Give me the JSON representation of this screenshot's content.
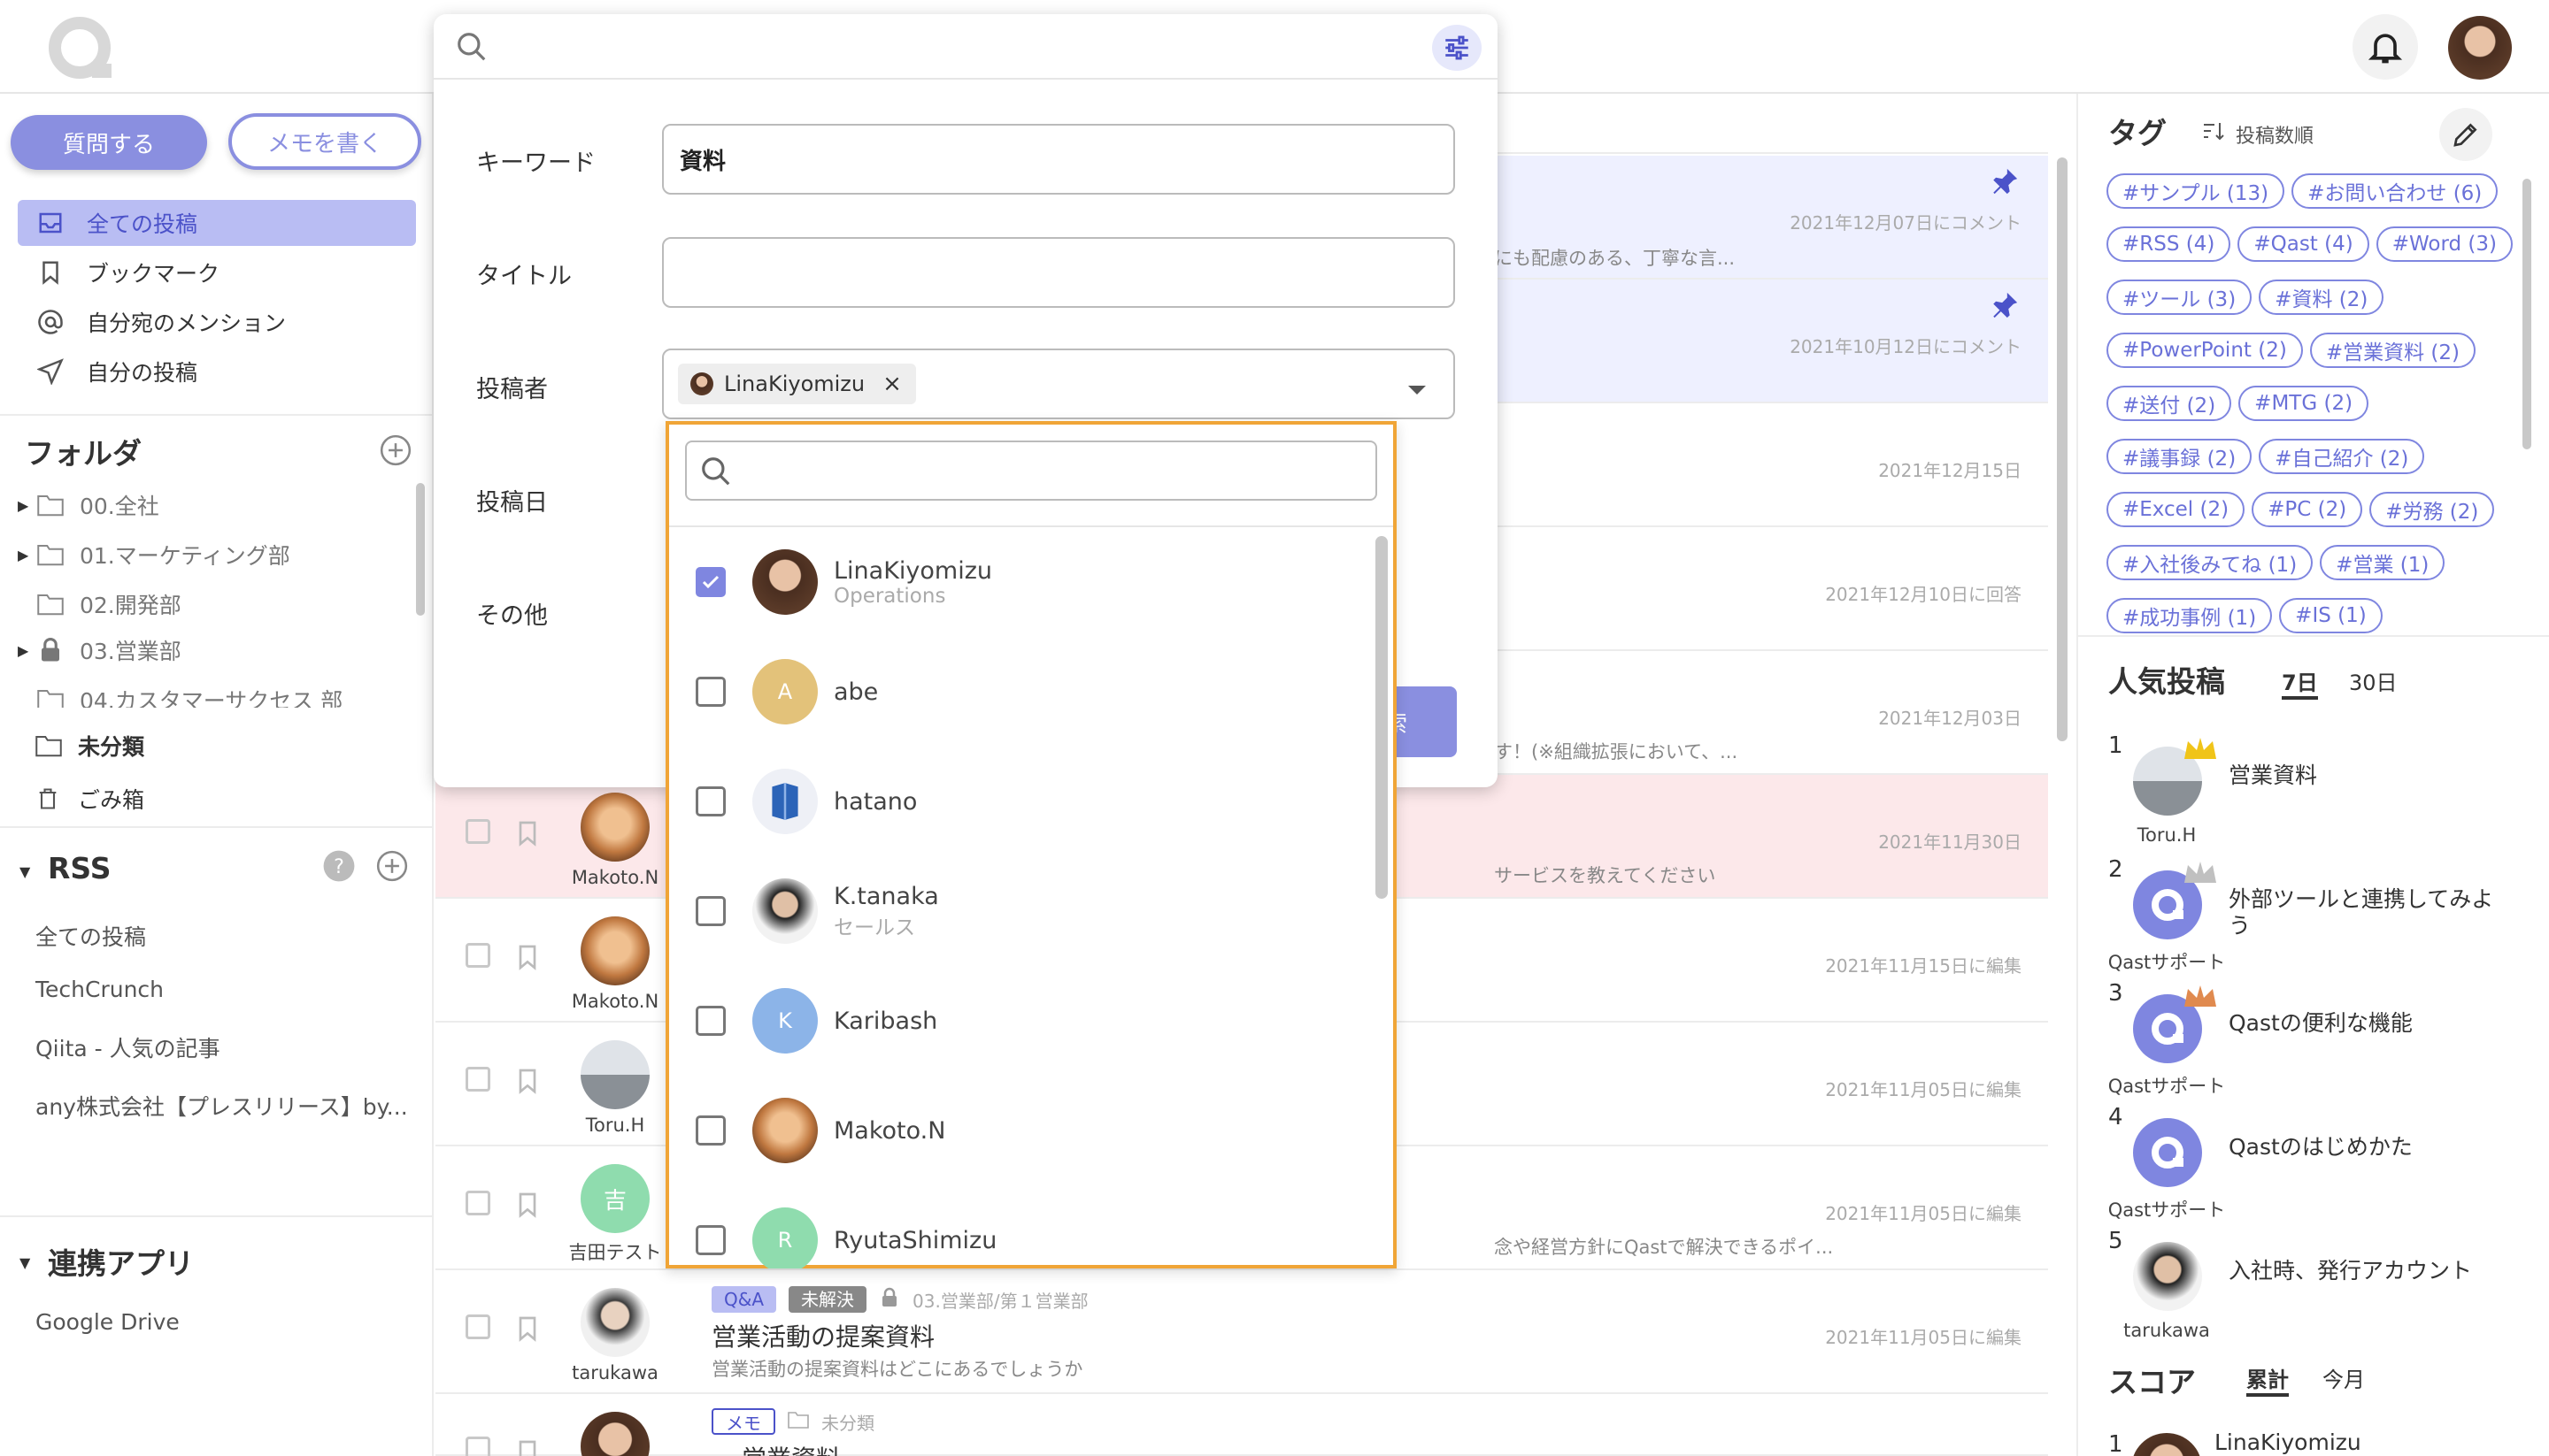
{
  "left": {
    "ask_button": "質問する",
    "memo_button": "メモを書く",
    "nav": [
      {
        "label": "全ての投稿",
        "icon": "inbox-icon"
      },
      {
        "label": "ブックマーク",
        "icon": "bookmark-icon"
      },
      {
        "label": "自分宛のメンション",
        "icon": "at-icon"
      },
      {
        "label": "自分の投稿",
        "icon": "send-icon"
      }
    ],
    "folder_title": "フォルダ",
    "folders": [
      {
        "label": "00.全社",
        "has_children": true,
        "locked": false
      },
      {
        "label": "01.マーケティング部",
        "has_children": true,
        "locked": false
      },
      {
        "label": "02.開発部",
        "has_children": false,
        "locked": false
      },
      {
        "label": "03.営業部",
        "has_children": true,
        "locked": true
      },
      {
        "label": "04.カスタマーサクセス 部",
        "has_children": false,
        "locked": false
      }
    ],
    "uncategorized": "未分類",
    "trash": "ごみ箱",
    "rss_title": "RSS",
    "rss_items": [
      "全ての投稿",
      "TechCrunch",
      "Qiita - 人気の記事",
      "any株式会社【プレスリリース】by..."
    ],
    "apps_title": "連携アプリ",
    "apps": [
      "Google Drive"
    ]
  },
  "search": {
    "keyword_label": "キーワード",
    "keyword_value": "資料",
    "title_label": "タイトル",
    "title_value": "",
    "author_label": "投稿者",
    "author_chip": "LinaKiyomizu",
    "author_chip_remove": "×",
    "date_label": "投稿日",
    "other_label": "その他",
    "search_button_partial": "索"
  },
  "dropdown": {
    "search_placeholder": "",
    "users": [
      {
        "name": "LinaKiyomizu",
        "sub": "Operations",
        "checked": true,
        "avatar": "photo",
        "initial": ""
      },
      {
        "name": "abe",
        "sub": "",
        "checked": false,
        "avatar": "letter",
        "initial": "A",
        "color": "#e3c27a"
      },
      {
        "name": "hatano",
        "sub": "",
        "checked": false,
        "avatar": "logo",
        "initial": ""
      },
      {
        "name": "K.tanaka",
        "sub": "セールス",
        "checked": false,
        "avatar": "photo",
        "initial": ""
      },
      {
        "name": "Karibash",
        "sub": "",
        "checked": false,
        "avatar": "letter",
        "initial": "K",
        "color": "#8cb4e8"
      },
      {
        "name": "Makoto.N",
        "sub": "",
        "checked": false,
        "avatar": "photo",
        "initial": ""
      },
      {
        "name": "RyutaShimizu",
        "sub": "",
        "checked": false,
        "avatar": "letter",
        "initial": "R",
        "color": "#8fdcae"
      }
    ]
  },
  "posts": [
    {
      "date": "2021年12月07日にコメント",
      "excerpt": "にも配慮のある、丁寧な言...",
      "pinned": true,
      "user": ""
    },
    {
      "date": "2021年10月12日にコメント",
      "excerpt": "",
      "pinned": true,
      "user": ""
    },
    {
      "date": "2021年12月15日",
      "excerpt": "",
      "pinned": false,
      "user": ""
    },
    {
      "date": "2021年12月10日に回答",
      "excerpt": "",
      "pinned": false,
      "user": ""
    },
    {
      "date": "2021年12月03日",
      "excerpt": "す！(※組織拡張において、...",
      "pinned": false,
      "user": ""
    },
    {
      "date": "2021年11月30日",
      "excerpt": "サービスを教えてください",
      "pinned": false,
      "user": "Makoto.N"
    },
    {
      "date": "2021年11月15日に編集",
      "excerpt": "",
      "pinned": false,
      "user": "Makoto.N"
    },
    {
      "date": "2021年11月05日に編集",
      "excerpt": "",
      "pinned": false,
      "user": "Toru.H"
    },
    {
      "date": "2021年11月05日に編集",
      "excerpt": "念や経営方針にQastで解決できるポイ...",
      "pinned": false,
      "user": "吉田テスト",
      "initial": "吉"
    },
    {
      "date": "2021年11月05日に編集",
      "excerpt": "営業活動の提案資料はどこにあるでしょうか",
      "pinned": false,
      "user": "tarukawa",
      "title": "営業活動の提案資料",
      "badge1": "Q&A",
      "badge2": "未解決",
      "folder": "03.営業部/第１営業部"
    },
    {
      "date": "",
      "excerpt": "",
      "pinned": false,
      "user": "",
      "badge1": "メモ",
      "folder": "未分類",
      "title": "営業資料"
    }
  ],
  "right": {
    "tags_title": "タグ",
    "sort_label": "投稿数順",
    "tags": [
      "#サンプル (13)",
      "#お問い合わせ (6)",
      "#RSS (4)",
      "#Qast (4)",
      "#Word (3)",
      "#ツール (3)",
      "#資料 (2)",
      "#PowerPoint (2)",
      "#営業資料 (2)",
      "#送付 (2)",
      "#MTG (2)",
      "#議事録 (2)",
      "#自己紹介 (2)",
      "#Excel (2)",
      "#PC (2)",
      "#労務 (2)",
      "#入社後みてね (1)",
      "#営業 (1)",
      "#成功事例 (1)",
      "#IS (1)"
    ],
    "popular_title": "人気投稿",
    "tab_7d": "7日",
    "tab_30d": "30日",
    "ranking": [
      {
        "rank": "1",
        "title": "営業資料",
        "user": "Toru.H",
        "avatar": "photo",
        "crown": "#f0c419"
      },
      {
        "rank": "2",
        "title": "外部ツールと連携してみよう",
        "user": "Qastサポート",
        "avatar": "qast",
        "crown": "#c0c0c0"
      },
      {
        "rank": "3",
        "title": "Qastの便利な機能",
        "user": "Qastサポート",
        "avatar": "qast",
        "crown": "#e08a4f"
      },
      {
        "rank": "4",
        "title": "Qastのはじめかた",
        "user": "Qastサポート",
        "avatar": "qast",
        "crown": ""
      },
      {
        "rank": "5",
        "title": "入社時、発行アカウント",
        "user": "tarukawa",
        "avatar": "photo",
        "crown": ""
      }
    ],
    "score_title": "スコア",
    "tab_total": "累計",
    "tab_month": "今月",
    "score_first_rank": "1",
    "score_first_user": "LinaKiyomizu"
  }
}
